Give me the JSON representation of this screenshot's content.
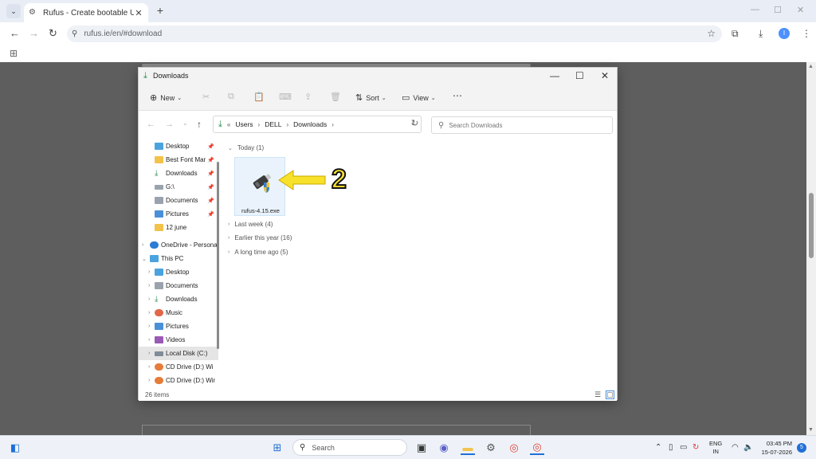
{
  "browser": {
    "tab_title": "Rufus - Create bootable USB dr",
    "url": "rufus.ie/en/#download",
    "profile_initial": "I"
  },
  "explorer": {
    "title": "Downloads",
    "cmd": {
      "new": "New",
      "sort": "Sort",
      "view": "View"
    },
    "breadcrumb": [
      "Users",
      "DELL",
      "Downloads"
    ],
    "search_placeholder": "Search Downloads",
    "nav_items": [
      {
        "label": "Desktop",
        "icon": "desktop-icon"
      },
      {
        "label": "Best Font Mar",
        "icon": "folder-icon"
      },
      {
        "label": "Downloads",
        "icon": "download-icon"
      },
      {
        "label": "G:\\",
        "icon": "drive-icon"
      },
      {
        "label": "Documents",
        "icon": "documents-icon"
      },
      {
        "label": "Pictures",
        "icon": "pictures-icon"
      },
      {
        "label": "12 june",
        "icon": "folder-icon"
      },
      {
        "label": "OneDrive - Persona",
        "icon": "onedrive-icon"
      },
      {
        "label": "This PC",
        "icon": "pc-icon"
      },
      {
        "label": "Desktop",
        "icon": "desktop-icon"
      },
      {
        "label": "Documents",
        "icon": "documents-icon"
      },
      {
        "label": "Downloads",
        "icon": "download-icon"
      },
      {
        "label": "Music",
        "icon": "music-icon"
      },
      {
        "label": "Pictures",
        "icon": "pictures-icon"
      },
      {
        "label": "Videos",
        "icon": "videos-icon"
      },
      {
        "label": "Local Disk (C:)",
        "icon": "disk-icon"
      },
      {
        "label": "CD Drive (D:) Wi",
        "icon": "cd-icon"
      },
      {
        "label": "CD Drive (D:) Win",
        "icon": "cd-icon"
      }
    ],
    "groups": {
      "today": "Today (1)",
      "last_week": "Last week (4)",
      "earlier_year": "Earlier this year (16)",
      "long_ago": "A long time ago (5)"
    },
    "file_name": "rufus-4.15.exe",
    "annotation_number": "2",
    "item_count": "26 items"
  },
  "taskbar": {
    "search_placeholder": "Search",
    "lang_line1": "ENG",
    "lang_line2": "IN",
    "time": "03:45 PM",
    "date": "15-07-2026",
    "notification_count": "5"
  },
  "colors": {
    "accent": "#1f6fd6",
    "download_green": "#2c8b4e",
    "annotation_yellow": "#f7e12a"
  }
}
